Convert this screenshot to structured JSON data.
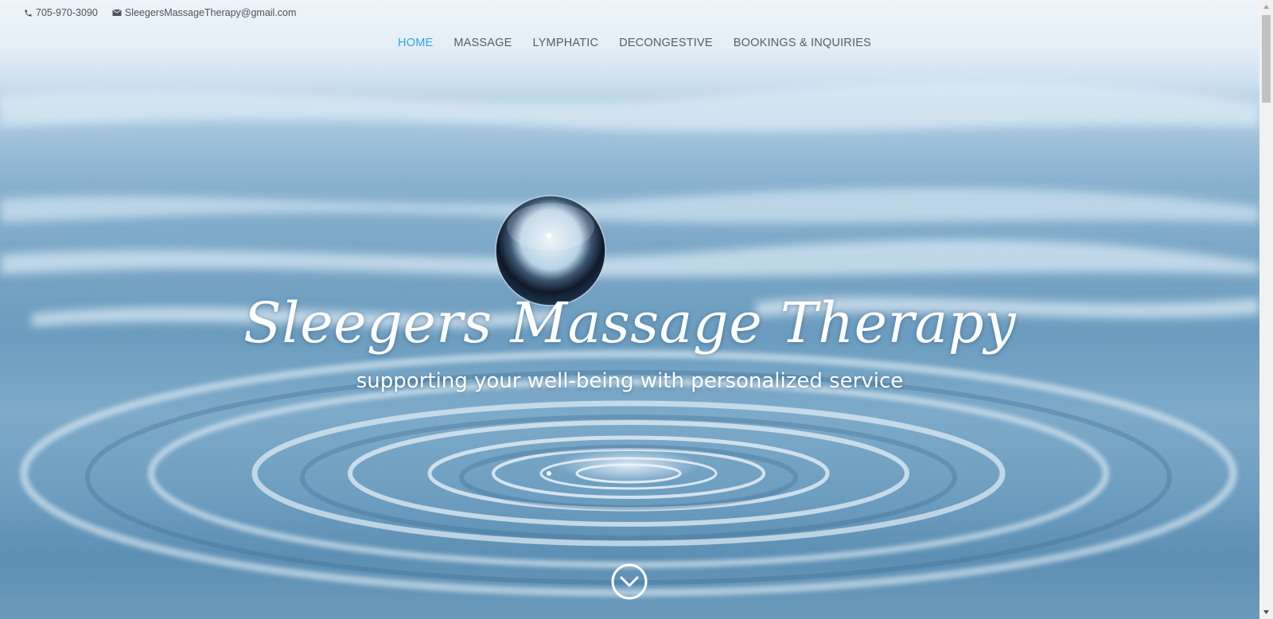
{
  "contact": {
    "phone": "705-970-3090",
    "email": "SleegersMassageTherapy@gmail.com",
    "phone_icon": "phone-icon",
    "email_icon": "envelope-icon"
  },
  "nav": {
    "items": [
      {
        "label": "HOME",
        "active": true
      },
      {
        "label": "MASSAGE",
        "active": false
      },
      {
        "label": "LYMPHATIC",
        "active": false
      },
      {
        "label": "DECONGESTIVE",
        "active": false
      },
      {
        "label": "BOOKINGS & INQUIRIES",
        "active": false
      }
    ]
  },
  "hero": {
    "title": "Sleegers Massage Therapy",
    "subtitle": "supporting your well-being with personalized service",
    "scroll_icon": "chevron-down-circle-icon"
  },
  "colors": {
    "accent": "#2ea3f2",
    "nav_text": "#555e66",
    "hero_text": "#ffffff"
  }
}
